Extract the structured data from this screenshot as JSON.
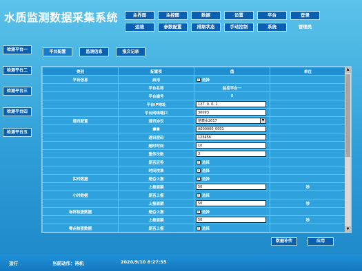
{
  "app": {
    "title": "水质监测数据采集系统"
  },
  "menu": {
    "row1": [
      "主界面",
      "主控图",
      "数据",
      "设置",
      "平台",
      "登录"
    ],
    "row2": [
      "运维",
      "参数配置",
      "排期状态",
      "手动控制",
      "系统"
    ],
    "user_label": "管理员"
  },
  "sidebar": {
    "items": [
      "检测平台一",
      "检测平台二",
      "检测平台三",
      "检测平台四",
      "检测平台五"
    ]
  },
  "tabs": {
    "items": [
      "平台配置",
      "监测信息",
      "报文记录"
    ],
    "active": 0
  },
  "table": {
    "headers": [
      "类别",
      "配置项",
      "值",
      "单位"
    ],
    "rows": [
      {
        "cat": "平台信息",
        "item": "启用",
        "type": "check",
        "value": "选择",
        "unit": ""
      },
      {
        "cat": "",
        "item": "平台名称",
        "type": "text",
        "value": "监控平台一",
        "unit": ""
      },
      {
        "cat": "",
        "item": "平台编号",
        "type": "text",
        "value": "0",
        "unit": ""
      },
      {
        "cat": "",
        "item": "平台IP地址",
        "type": "input",
        "value": "127. 0. 0. 1",
        "unit": ""
      },
      {
        "cat": "",
        "item": "平台网络端口",
        "type": "input",
        "value": "30093",
        "unit": ""
      },
      {
        "cat": "通讯配置",
        "item": "通讯协议",
        "type": "select",
        "value": "地表水2017",
        "unit": ""
      },
      {
        "cat": "",
        "item": "■■",
        "type": "input",
        "value": "A000000_0001",
        "unit": ""
      },
      {
        "cat": "",
        "item": "通讯密码",
        "type": "input",
        "value": "123456",
        "unit": ""
      },
      {
        "cat": "",
        "item": "超时时间",
        "type": "input",
        "value": "10",
        "unit": ""
      },
      {
        "cat": "",
        "item": "重传次数",
        "type": "input",
        "value": "3",
        "unit": ""
      },
      {
        "cat": "",
        "item": "是否应答",
        "type": "check",
        "value": "选择",
        "unit": ""
      },
      {
        "cat": "",
        "item": "时间校准",
        "type": "check",
        "value": "选择",
        "unit": ""
      },
      {
        "cat": "实时数据",
        "item": "是否上报",
        "type": "check",
        "value": "选择",
        "unit": ""
      },
      {
        "cat": "",
        "item": "上报周期",
        "type": "input",
        "value": "50",
        "unit": "秒"
      },
      {
        "cat": "小时数据",
        "item": "是否上报",
        "type": "check",
        "value": "选择",
        "unit": ""
      },
      {
        "cat": "",
        "item": "上报周期",
        "type": "input",
        "value": "50",
        "unit": "秒"
      },
      {
        "cat": "标样核查数据",
        "item": "是否上报",
        "type": "check",
        "value": "选择",
        "unit": ""
      },
      {
        "cat": "",
        "item": "上报周期",
        "type": "input",
        "value": "50",
        "unit": "秒"
      },
      {
        "cat": "零点核查数据",
        "item": "是否上报",
        "type": "check",
        "value": "选择",
        "unit": ""
      }
    ]
  },
  "actions": {
    "reupload": "数据补传",
    "apply": "应用"
  },
  "status": {
    "run": "运行",
    "action": "当前动作：待机",
    "time": "2020/9/10  8:27:55"
  }
}
